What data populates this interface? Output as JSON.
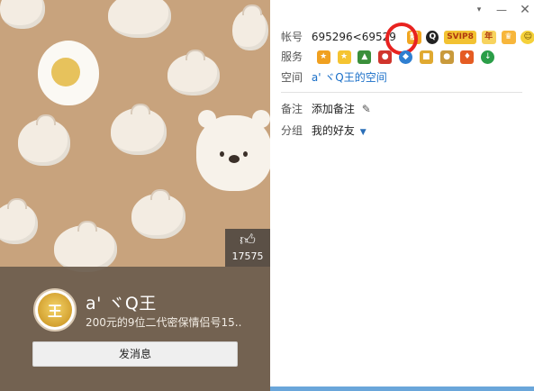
{
  "window": {
    "controls": {
      "dropdown": "▾",
      "minimize": "—",
      "close": "✕"
    }
  },
  "cover": {
    "like_icon": "thumbs-up-icon",
    "like_count": "17575"
  },
  "card": {
    "avatar_glyph": "王",
    "nickname": "a' ヾQ王",
    "signature": "200元的9位二代密保情侣号15..",
    "message_button": "发消息"
  },
  "info": {
    "account": {
      "label": "帐号",
      "value": "695296<69529",
      "badges": [
        "靓",
        "Q",
        "SVIP8",
        "年",
        "♛",
        "☺",
        "★"
      ]
    },
    "services": {
      "label": "服务",
      "icons": [
        "#f0a020",
        "#f5c431",
        "#3a8f3a",
        "#d0342c",
        "#2f7fd1",
        "#e0a930",
        "#c99a3c",
        "#e55c23",
        "#2b9e48"
      ]
    },
    "space": {
      "label": "空间",
      "value": "a' ヾQ王的空间"
    },
    "remark": {
      "label": "备注",
      "value": "添加备注"
    },
    "group": {
      "label": "分组",
      "value": "我的好友"
    }
  }
}
